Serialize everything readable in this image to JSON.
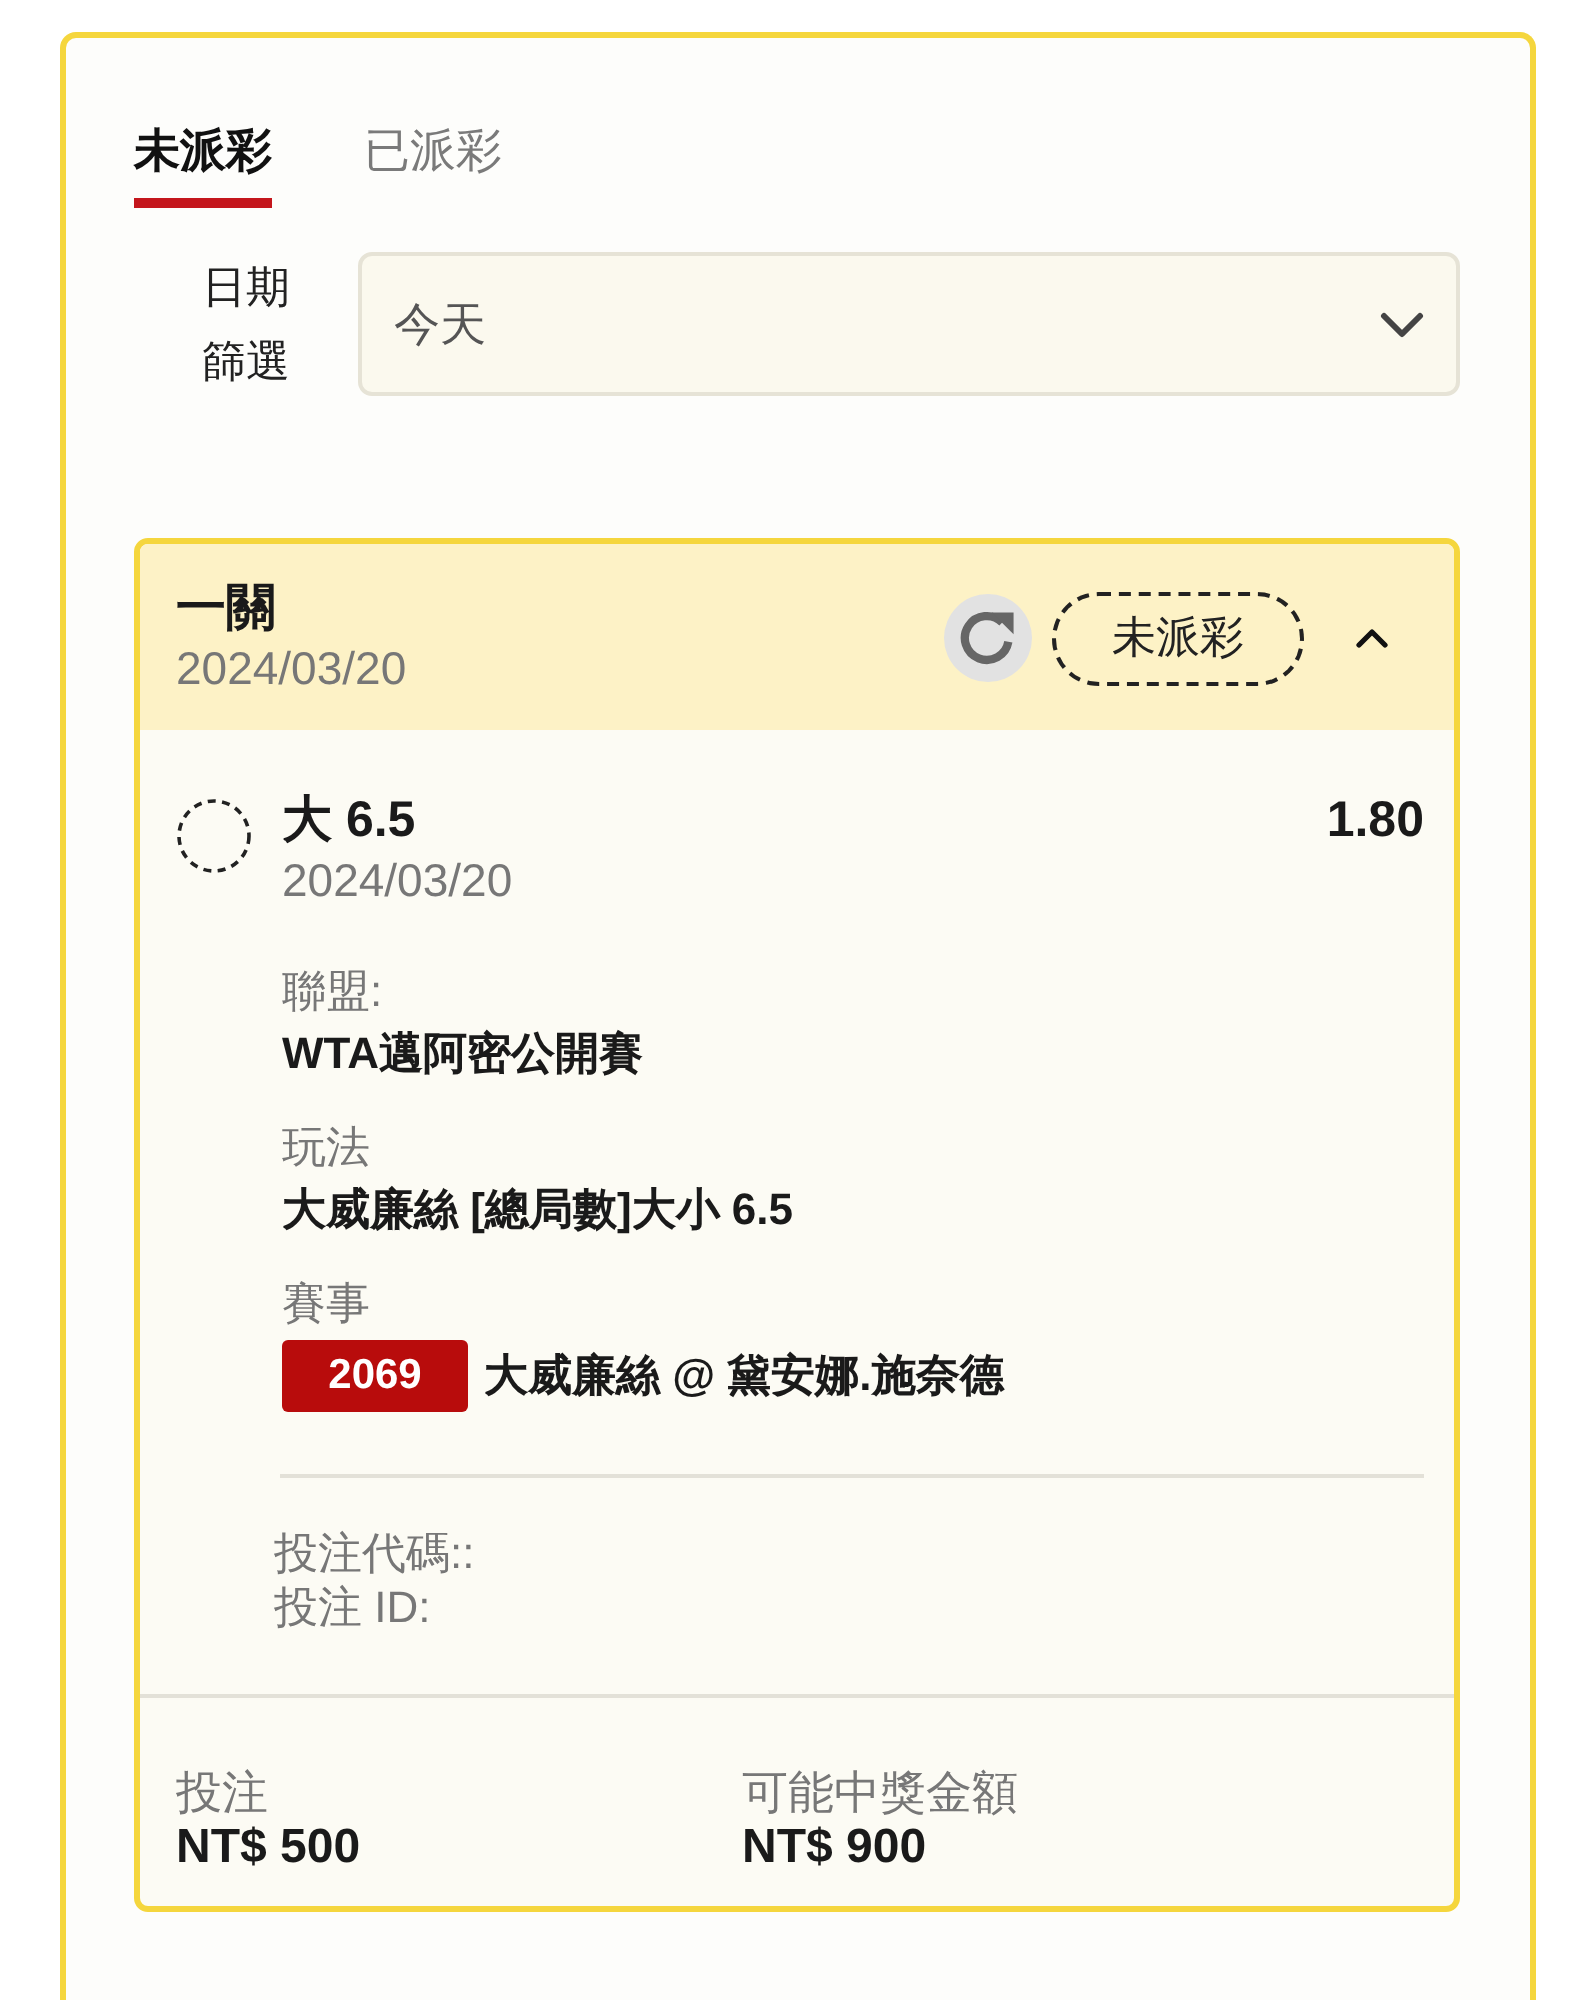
{
  "tabs": [
    {
      "label": "未派彩",
      "selected": true
    },
    {
      "label": "已派彩",
      "selected": false
    }
  ],
  "date_filter": {
    "label": "日期篩選",
    "value": "今天"
  },
  "bet_card": {
    "title": "一關",
    "date": "2024/03/20",
    "status": "未派彩",
    "expanded": true,
    "legs": [
      {
        "selection": "大 6.5",
        "odds": "1.80",
        "date": "2024/03/20",
        "details": [
          {
            "label": "聯盟:",
            "value": "WTA邁阿密公開賽"
          },
          {
            "label": "玩法",
            "value": "大威廉絲 [總局數]大小 6.5"
          },
          {
            "label": "賽事",
            "event_code": "2069",
            "value": "大威廉絲 @ 黛安娜.施奈德"
          }
        ]
      }
    ],
    "references": [
      "投注代碼::",
      "投注 ID:"
    ],
    "summary": [
      {
        "label": "投注",
        "value": "NT$ 500"
      },
      {
        "label": "可能中獎金額",
        "value": "NT$ 900"
      }
    ]
  }
}
